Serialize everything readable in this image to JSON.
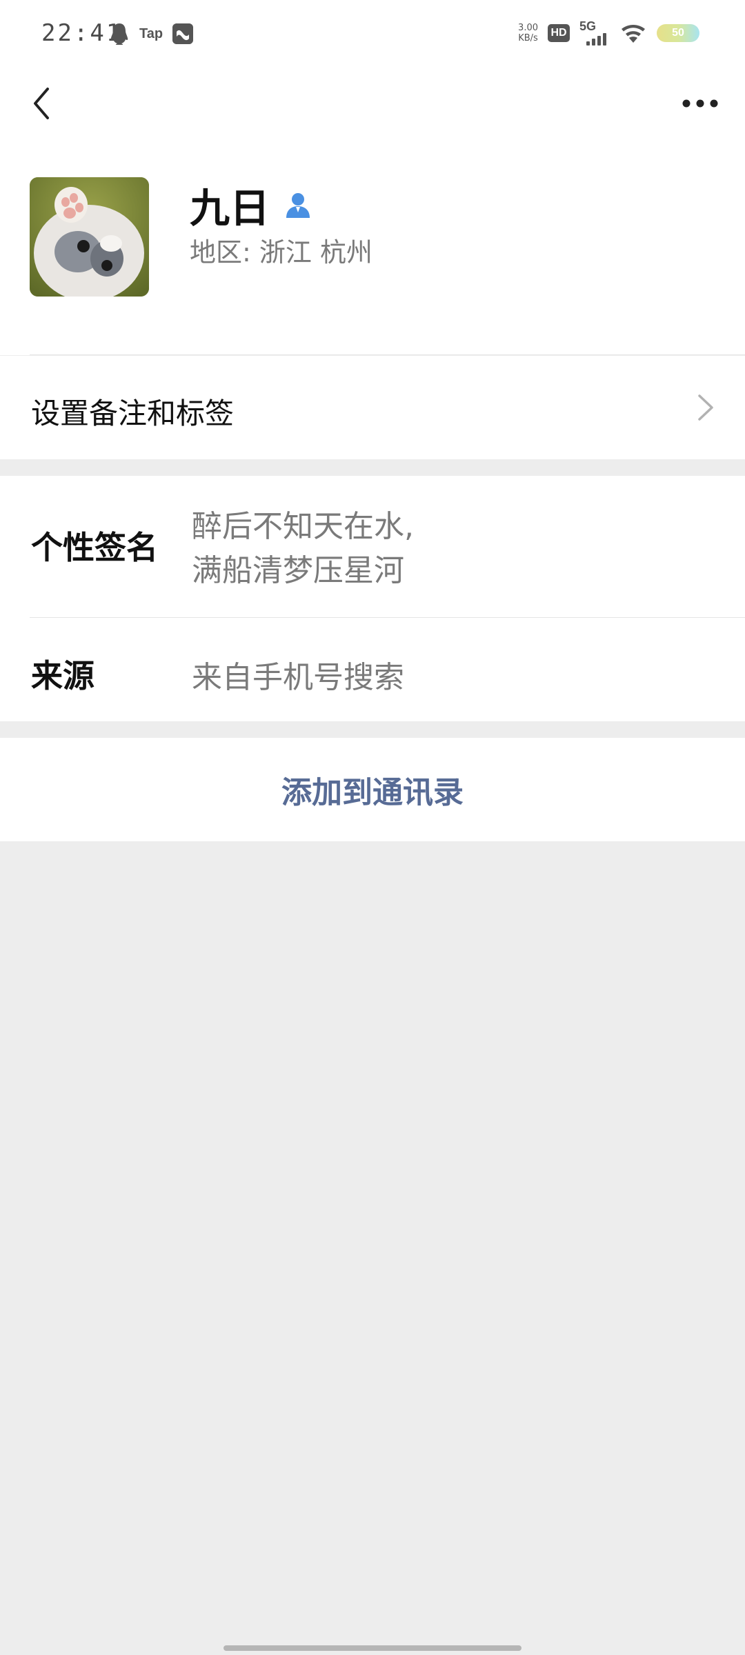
{
  "status_bar": {
    "time": "22:41",
    "tap_label": "Tap",
    "net_speed_value": "3.00",
    "net_speed_unit": "KB/s",
    "hd_label": "HD",
    "network_label": "5G",
    "battery_level": "50"
  },
  "icons": {
    "back": "back-chevron-icon",
    "more": "more-dots-icon",
    "gender": "person-icon",
    "chevron": "chevron-right-icon"
  },
  "profile": {
    "name": "九日",
    "region": "地区: 浙江 杭州"
  },
  "remark": {
    "label": "设置备注和标签"
  },
  "info": {
    "signature_key": "个性签名",
    "signature_line1": "醉后不知天在水,",
    "signature_line2": "满船清梦压星河",
    "source_key": "来源",
    "source_value": "来自手机号搜索"
  },
  "actions": {
    "add_contact": "添加到通讯录"
  },
  "colors": {
    "link": "#576b95",
    "background": "#ededed",
    "gender_icon": "#4a90e2"
  }
}
